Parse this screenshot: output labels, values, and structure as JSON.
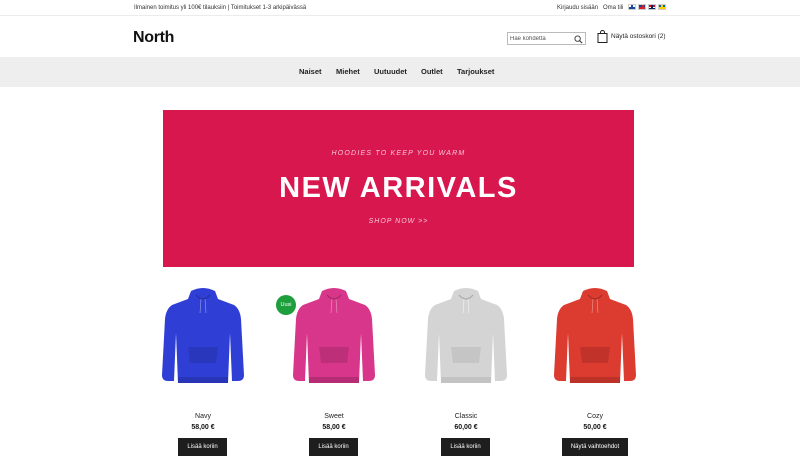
{
  "topbar": {
    "promo": "Ilmainen toimitus yli 100€ tilauksiin | Toimitukset 1-3 arkipäivässä",
    "login": "Kirjaudu sisään",
    "account": "Oma tili",
    "flags": [
      "fi-flag-icon",
      "gb-flag-icon",
      "no-flag-icon",
      "se-flag-icon"
    ]
  },
  "header": {
    "logo": "North",
    "search_placeholder": "Hae kohdetta",
    "cart_label": "Näytä ostoskori (2)"
  },
  "nav": {
    "items": [
      "Naiset",
      "Miehet",
      "Uutuudet",
      "Outlet",
      "Tarjoukset"
    ]
  },
  "hero": {
    "kicker": "HOODIES TO KEEP YOU WARM",
    "title": "NEW ARRIVALS",
    "cta": "SHOP NOW >>",
    "color": "#d8174f"
  },
  "products": [
    {
      "name": "Navy",
      "price": "58,00 €",
      "button": "Lisää koriin",
      "color": "#2f3fd6",
      "badge": ""
    },
    {
      "name": "Sweet",
      "price": "58,00 €",
      "button": "Lisää koriin",
      "color": "#d8368a",
      "badge": "Uusi"
    },
    {
      "name": "Classic",
      "price": "60,00 €",
      "button": "Lisää koriin",
      "color": "#d4d4d4",
      "badge": ""
    },
    {
      "name": "Cozy",
      "price": "50,00 €",
      "button": "Näytä vaihtoehdot",
      "color": "#dc3b30",
      "badge": ""
    }
  ],
  "colors": {
    "nav_bg": "#eeeeee",
    "button_bg": "#1e1e1e",
    "badge_bg": "#1e9e3c"
  }
}
